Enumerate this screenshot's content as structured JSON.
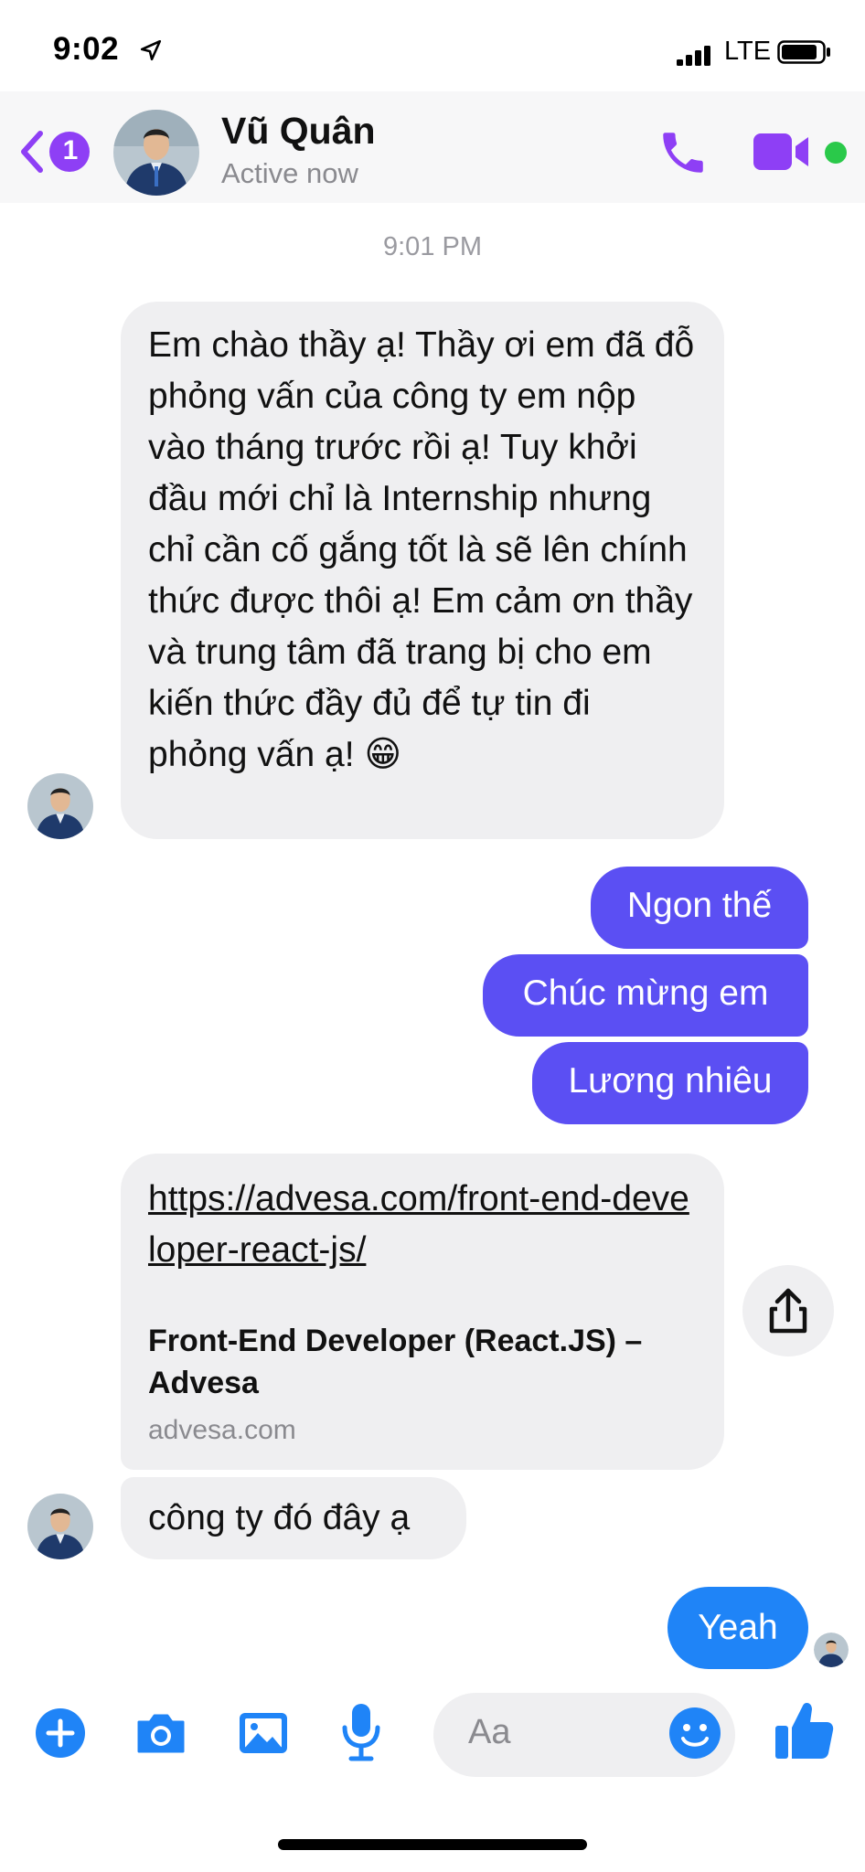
{
  "status_bar": {
    "time": "9:02",
    "carrier": "LTE"
  },
  "header": {
    "badge_count": "1",
    "contact_name": "Vũ Quân",
    "contact_status": "Active now"
  },
  "colors": {
    "accent": "#8e3ff5",
    "outgoing_bubble": "#5b4ff3",
    "last_bubble": "#1f84f7",
    "incoming_bubble": "#efeff1",
    "online": "#2ac94a"
  },
  "conversation": {
    "timestamp": "9:01 PM",
    "msg_intro": "Em chào thầy ạ! Thầy ơi em đã đỗ phỏng vấn của công ty em nộp vào tháng trước rồi ạ! Tuy khởi đầu mới chỉ là Internship nhưng chỉ cần cố gắng tốt là sẽ lên chính thức được thôi ạ! Em cảm ơn thầy và trung tâm đã trang bị cho em kiến thức đầy đủ để tự tin đi phỏng vấn ạ! 😁",
    "out_1": "Ngon thế",
    "out_2": "Chúc mừng em",
    "out_3": "Lương nhiêu",
    "link": {
      "url": "https://advesa.com/front-end-developer-react-js/",
      "title": "Front-End Developer (React.JS) – Advesa",
      "domain": "advesa.com"
    },
    "msg_company": "công ty đó đây ạ",
    "out_4": "Yeah"
  },
  "composer": {
    "placeholder": "Aa"
  },
  "icons": [
    "location-arrow-icon",
    "signal-icon",
    "battery-icon",
    "back-chevron-icon",
    "phone-icon",
    "video-camera-icon",
    "share-icon",
    "plus-icon",
    "camera-icon",
    "photo-icon",
    "microphone-icon",
    "emoji-icon",
    "thumbs-up-icon"
  ]
}
